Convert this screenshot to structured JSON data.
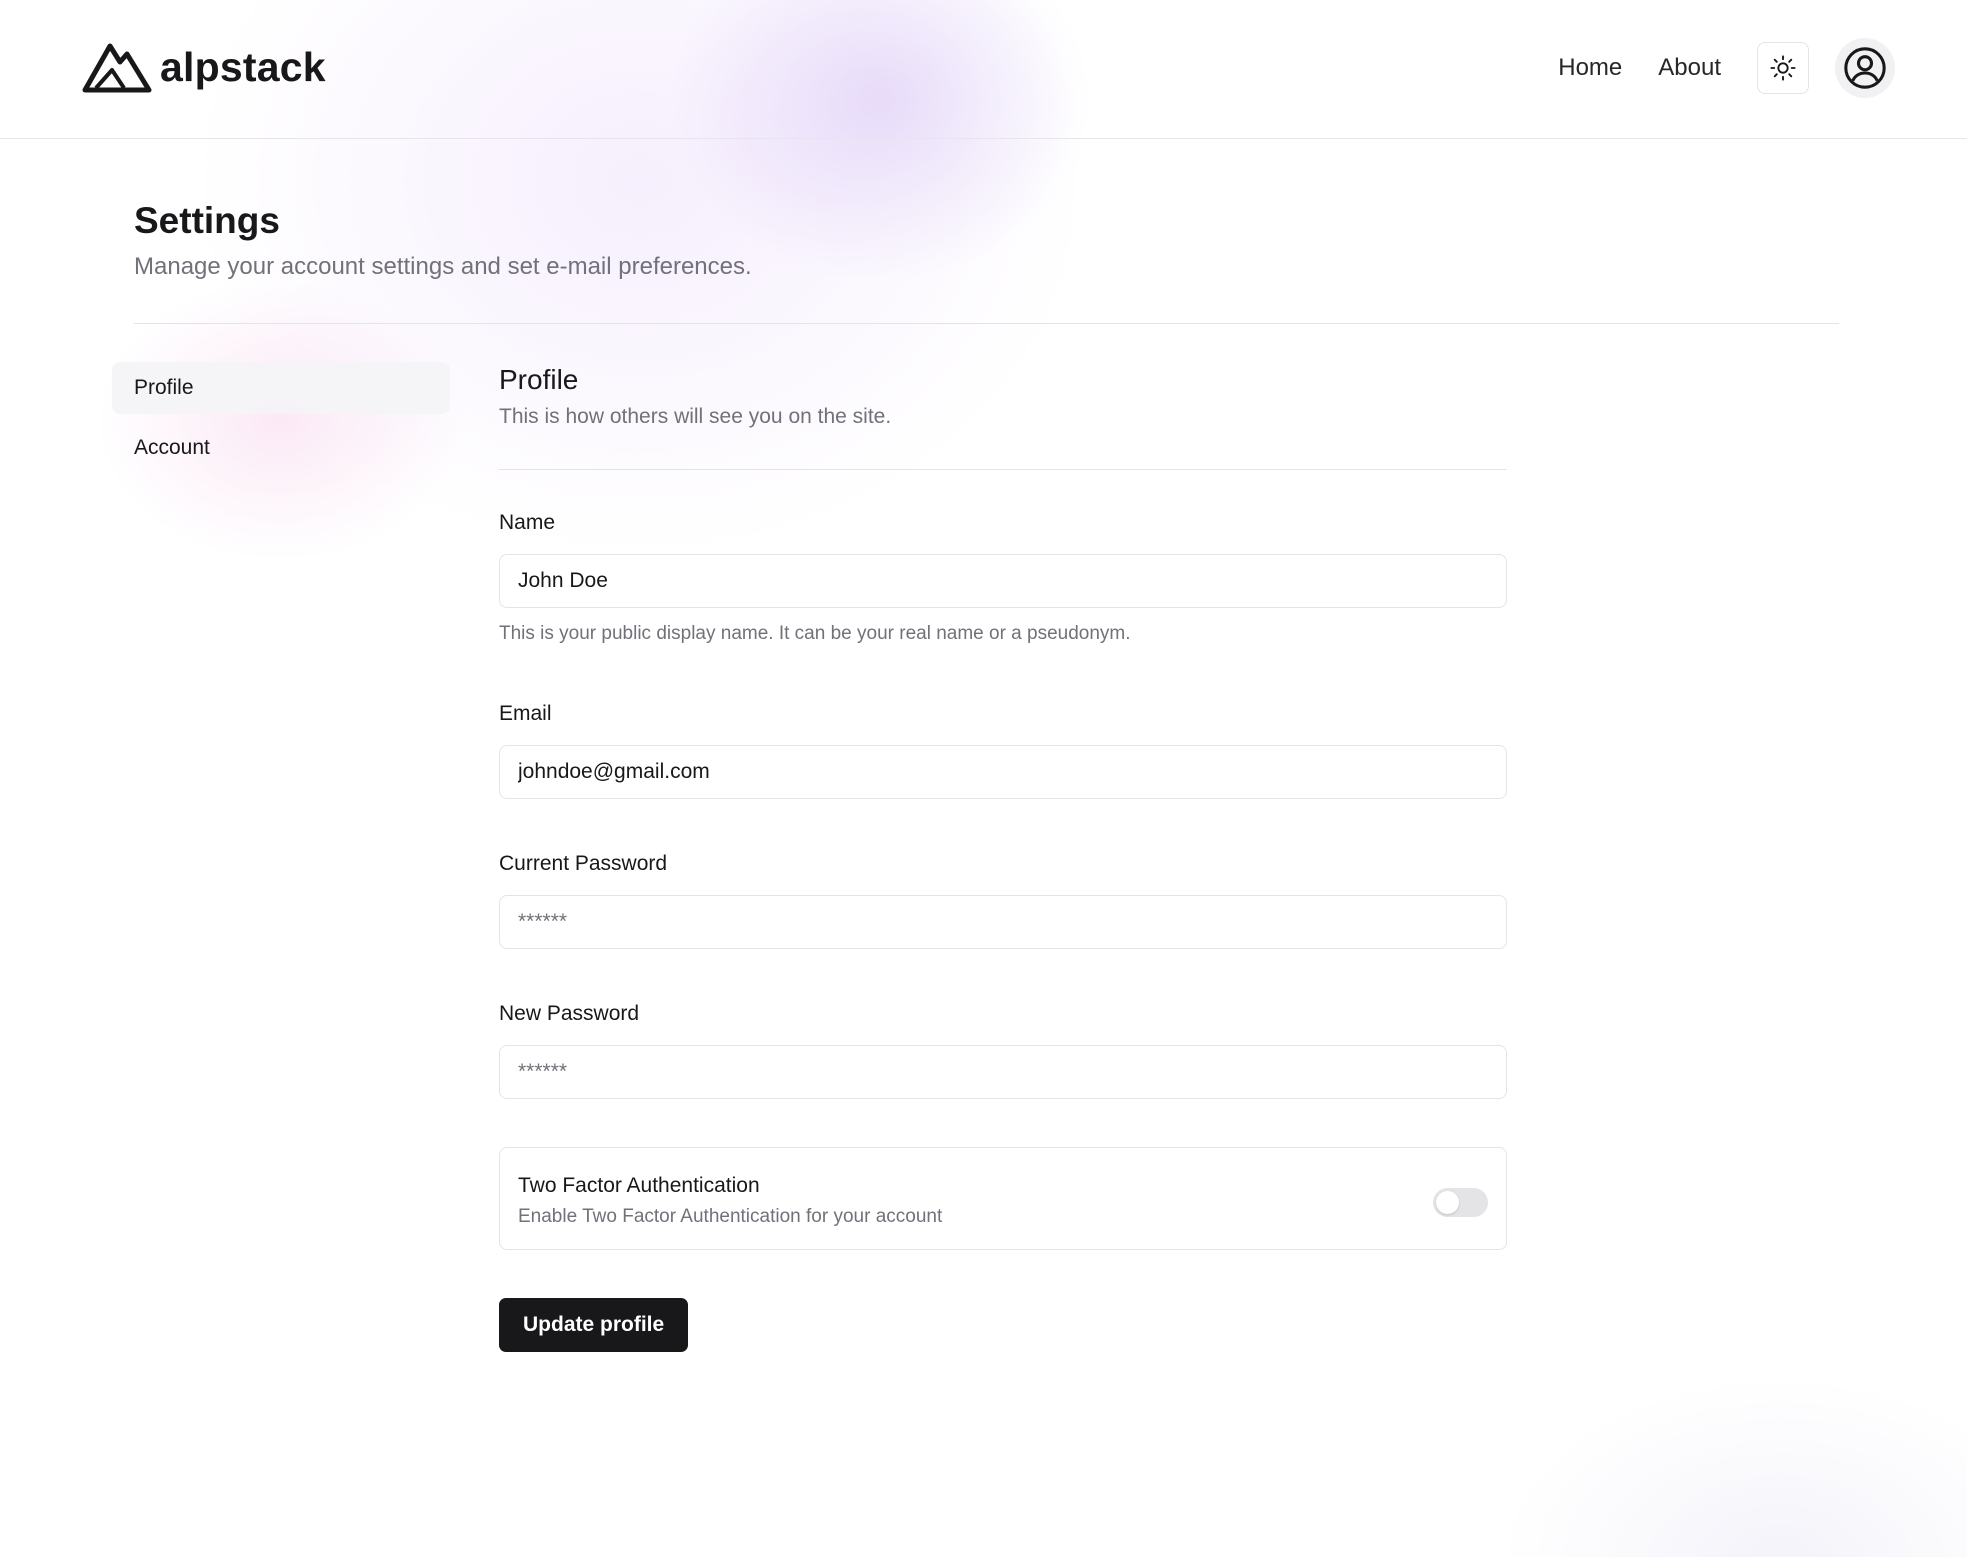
{
  "header": {
    "brand": "alpstack",
    "nav": [
      {
        "label": "Home"
      },
      {
        "label": "About"
      }
    ],
    "icons": {
      "logo": "mountain-logo-icon",
      "theme": "sun-icon",
      "user": "user-circle-icon"
    }
  },
  "page": {
    "title": "Settings",
    "subtitle": "Manage your account settings and set e-mail preferences."
  },
  "sidebar": {
    "items": [
      {
        "label": "Profile",
        "active": true
      },
      {
        "label": "Account",
        "active": false
      }
    ]
  },
  "section": {
    "title": "Profile",
    "description": "This is how others will see you on the site."
  },
  "form": {
    "name": {
      "label": "Name",
      "value": "John Doe",
      "hint": "This is your public display name. It can be your real name or a pseudonym."
    },
    "email": {
      "label": "Email",
      "value": "johndoe@gmail.com"
    },
    "current_password": {
      "label": "Current Password",
      "placeholder": "******"
    },
    "new_password": {
      "label": "New Password",
      "placeholder": "******"
    },
    "two_factor": {
      "title": "Two Factor Authentication",
      "description": "Enable Two Factor Authentication for your account",
      "enabled": false
    },
    "submit_label": "Update profile"
  },
  "colors": {
    "primary": "#18181b",
    "muted_text": "#71717a",
    "border": "#e4e4e7"
  }
}
